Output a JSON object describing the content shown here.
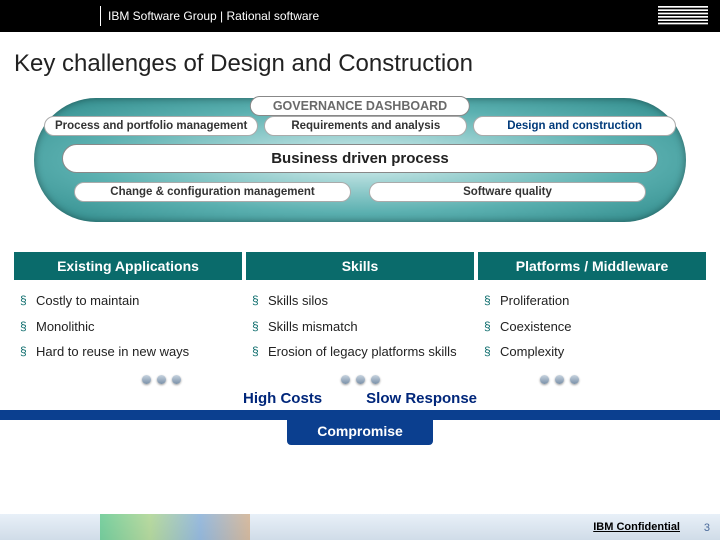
{
  "header": {
    "group": "IBM Software Group | Rational software"
  },
  "title": "Key challenges of Design and Construction",
  "governance": {
    "label": "GOVERNANCE DASHBOARD",
    "row1": [
      "Process and portfolio management",
      "Requirements and analysis",
      "Design and construction"
    ],
    "center": "Business driven process",
    "row2": [
      "Change & configuration management",
      "Software quality"
    ]
  },
  "columns": [
    {
      "head": "Existing Applications",
      "items": [
        "Costly to maintain",
        "Monolithic",
        "Hard to reuse in new ways"
      ]
    },
    {
      "head": "Skills",
      "items": [
        "Skills silos",
        "Skills mismatch",
        "Erosion of legacy platforms skills"
      ]
    },
    {
      "head": "Platforms / Middleware",
      "items": [
        "Proliferation",
        "Coexistence",
        "Complexity"
      ]
    }
  ],
  "summary": {
    "top": [
      "High Costs",
      "Slow Response"
    ],
    "bottom": "Compromise"
  },
  "footer": {
    "confidential": "IBM Confidential",
    "page": "3"
  }
}
